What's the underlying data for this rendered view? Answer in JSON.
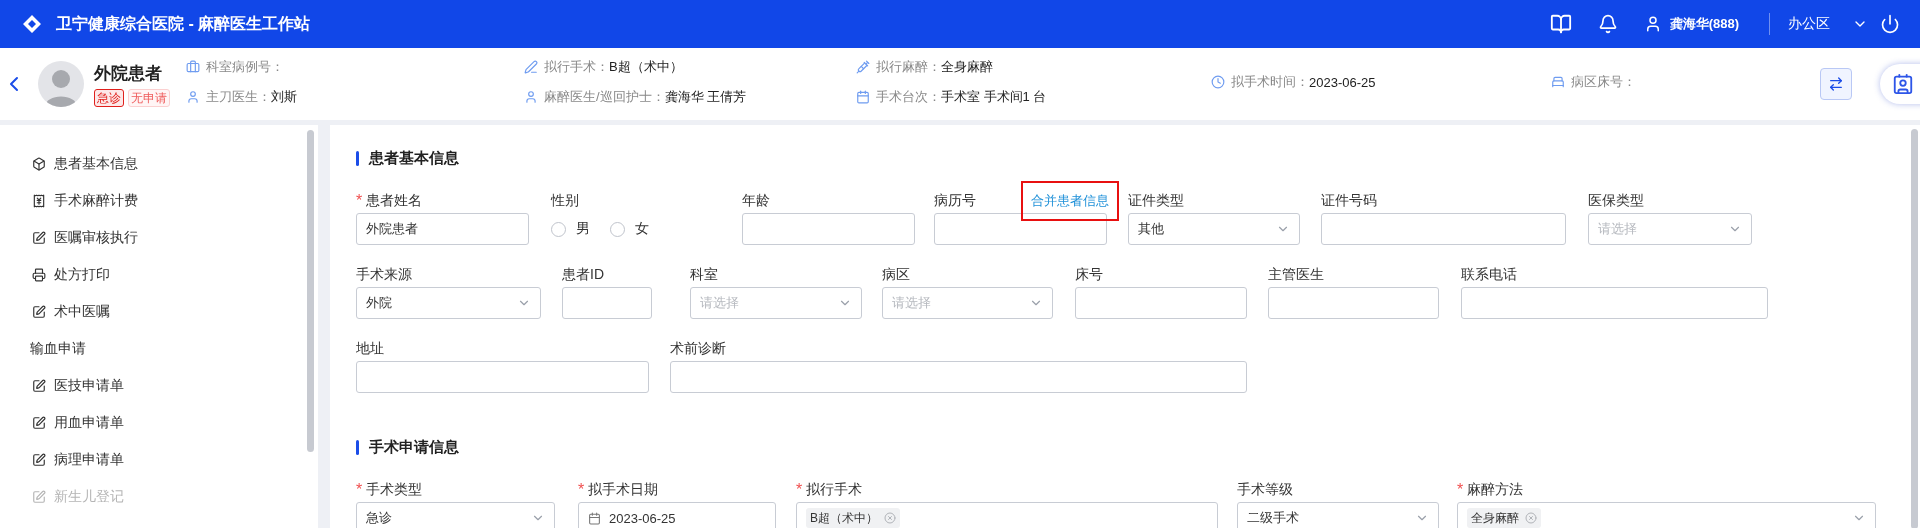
{
  "app": {
    "title": "卫宁健康综合医院 - 麻醉医生工作站",
    "user": "龚海华(888)",
    "area": "办公区"
  },
  "patient": {
    "name": "外院患者",
    "tags": [
      {
        "label": "急诊",
        "kind": "urgent"
      },
      {
        "label": "无申请",
        "kind": "none"
      }
    ],
    "info_columns": [
      [
        {
          "label": "科室病例号："
        },
        {
          "label": "主刀医生：",
          "value": "刘斯"
        }
      ],
      [
        {
          "label": "拟行手术：",
          "value": "B超（术中）"
        },
        {
          "label": "麻醉医生/巡回护士：",
          "value": "龚海华 王倩芳"
        }
      ],
      [
        {
          "label": "拟行麻醉：",
          "value": "全身麻醉"
        },
        {
          "label": "手术台次：",
          "value": "手术室 手术间1 台"
        }
      ],
      [
        {
          "label": "拟手术时间：",
          "value": "2023-06-25"
        }
      ],
      [
        {
          "label": "病区床号："
        }
      ]
    ]
  },
  "sidebar": {
    "items": [
      {
        "label": "患者基本信息",
        "kind": "item",
        "disabled": false
      },
      {
        "label": "手术麻醉计费",
        "kind": "item",
        "disabled": false
      },
      {
        "label": "医嘱审核执行",
        "kind": "item",
        "disabled": false
      },
      {
        "label": "处方打印",
        "kind": "item",
        "disabled": false
      },
      {
        "label": "术中医嘱",
        "kind": "item",
        "disabled": false
      },
      {
        "label": "输血申请",
        "kind": "group",
        "disabled": false
      },
      {
        "label": "医技申请单",
        "kind": "item",
        "disabled": false
      },
      {
        "label": "用血申请单",
        "kind": "item",
        "disabled": false
      },
      {
        "label": "病理申请单",
        "kind": "item",
        "disabled": false
      },
      {
        "label": "新生儿登记",
        "kind": "item",
        "disabled": true
      }
    ]
  },
  "sections": [
    {
      "title": "患者基本信息",
      "groups": [
        {
          "fields": [
            {
              "label": "患者姓名",
              "kind": "input",
              "mark": "*",
              "value": "外院患者"
            },
            {
              "label": "性别",
              "kind": "radio",
              "options": [
                {
                  "label": "男",
                  "selected": false
                },
                {
                  "label": "女",
                  "selected": false
                }
              ]
            },
            {
              "label": "年龄",
              "kind": "input"
            },
            {
              "label": "病历号",
              "kind": "input",
              "link": "合并患者信息"
            },
            {
              "label": "证件类型",
              "kind": "select",
              "value": "其他"
            },
            {
              "label": "证件号码",
              "kind": "input"
            },
            {
              "label": "医保类型",
              "kind": "select",
              "placeholder": "请选择"
            }
          ]
        },
        {
          "fields": [
            {
              "label": "手术来源",
              "kind": "select",
              "value": "外院"
            },
            {
              "label": "患者ID",
              "kind": "input"
            },
            {
              "label": "科室",
              "kind": "select",
              "placeholder": "请选择"
            },
            {
              "label": "病区",
              "kind": "select",
              "placeholder": "请选择"
            },
            {
              "label": "床号",
              "kind": "input"
            },
            {
              "label": "主管医生",
              "kind": "input"
            },
            {
              "label": "联系电话",
              "kind": "input"
            }
          ]
        },
        {
          "fields": [
            {
              "label": "地址",
              "kind": "input"
            },
            {
              "label": "术前诊断",
              "kind": "input"
            }
          ]
        }
      ]
    },
    {
      "title": "手术申请信息",
      "groups": [
        {
          "fields": [
            {
              "label": "手术类型",
              "kind": "select",
              "mark": "*",
              "value": "急诊"
            },
            {
              "label": "拟手术日期",
              "kind": "date",
              "mark": "*",
              "value": "2023-06-25"
            },
            {
              "label": "拟行手术",
              "kind": "tags",
              "mark": "*",
              "tags": [
                "B超（术中）"
              ]
            },
            {
              "label": "手术等级",
              "kind": "select",
              "value": "二级手术"
            },
            {
              "label": "麻醉方法",
              "kind": "tags",
              "mark": "*",
              "tags": [
                "全身麻醉"
              ],
              "dropdown": true
            }
          ]
        }
      ]
    }
  ]
}
